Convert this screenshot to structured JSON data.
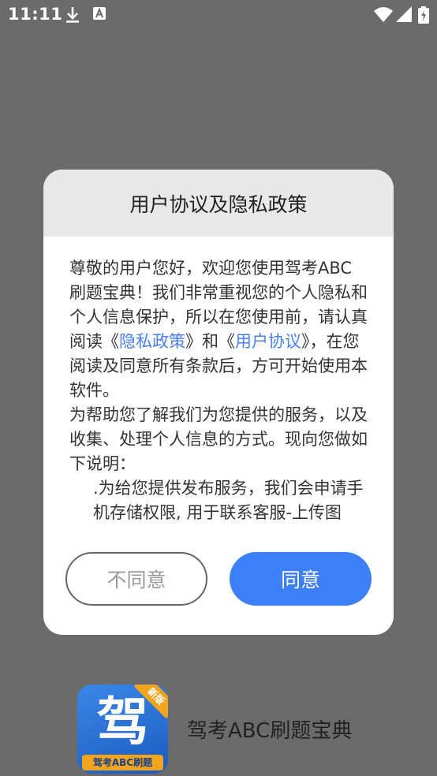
{
  "status_bar": {
    "time": "11:11",
    "icons": [
      "download-icon",
      "a-icon",
      "wifi-icon",
      "signal-icon",
      "battery-icon"
    ]
  },
  "dialog": {
    "title": "用户协议及隐私政策",
    "body": {
      "p1_before": "尊敬的用户您好，欢迎您使用驾考ABC刷题宝典！我们非常重视您的个人隐私和个人信息保护，所以在您使用前，请认真阅读",
      "bracket_open_1": "《",
      "privacy_link": "隐私政策",
      "between_links": "》和《",
      "agreement_link": "用户协议",
      "p1_after": "》，在您阅读及同意所有条款后，方可开始使用本软件。",
      "p2": "为帮助您了解我们为您提供的服务，以及收集、处理个人信息的方式。现向您做如下说明：",
      "p3": ".为给您提供发布服务，我们会申请手机存储权限, 用于联系客服-上传图"
    },
    "decline_label": "不同意",
    "agree_label": "同意"
  },
  "app": {
    "icon_char": "驾",
    "icon_badge": "新版",
    "icon_sub": "驾考ABC刷题",
    "name": "驾考ABC刷题宝典"
  },
  "colors": {
    "overlay": "#6b6b6b",
    "link": "#4a7ff0",
    "primary_button": "#3d7ff7"
  }
}
